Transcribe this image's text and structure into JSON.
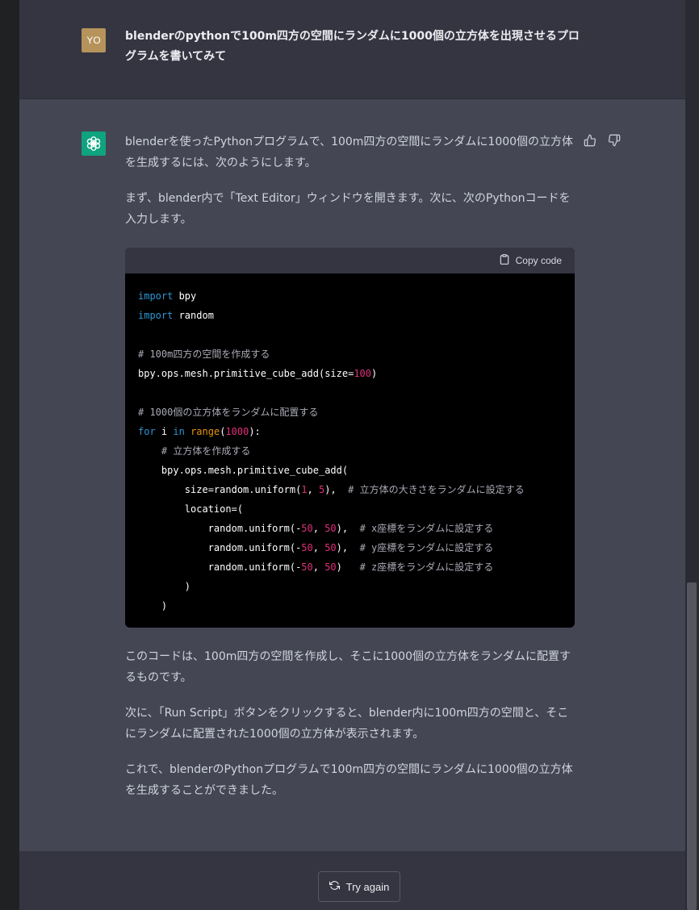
{
  "user_message": {
    "avatar_initials": "YO",
    "text": "blenderのpythonで100m四方の空間にランダムに1000個の立方体を出現させるプログラムを書いてみて"
  },
  "assistant_message": {
    "paragraph_1": "blenderを使ったPythonプログラムで、100m四方の空間にランダムに1000個の立方体を生成するには、次のようにします。",
    "paragraph_2": "まず、blender内で「Text Editor」ウィンドウを開きます。次に、次のPythonコードを入力します。",
    "code_block": {
      "copy_label": "Copy code",
      "lines": [
        {
          "parts": [
            {
              "t": "import",
              "c": "kw"
            },
            {
              "t": " bpy",
              "c": ""
            }
          ]
        },
        {
          "parts": [
            {
              "t": "import",
              "c": "kw"
            },
            {
              "t": " random",
              "c": ""
            }
          ]
        },
        {
          "parts": []
        },
        {
          "parts": [
            {
              "t": "# 100m四方の空間を作成する",
              "c": "cm"
            }
          ]
        },
        {
          "parts": [
            {
              "t": "bpy.ops.mesh.primitive_cube_add(size=",
              "c": ""
            },
            {
              "t": "100",
              "c": "num"
            },
            {
              "t": ")",
              "c": ""
            }
          ]
        },
        {
          "parts": []
        },
        {
          "parts": [
            {
              "t": "# 1000個の立方体をランダムに配置する",
              "c": "cm"
            }
          ]
        },
        {
          "parts": [
            {
              "t": "for",
              "c": "kw"
            },
            {
              "t": " i ",
              "c": ""
            },
            {
              "t": "in",
              "c": "kw"
            },
            {
              "t": " ",
              "c": ""
            },
            {
              "t": "range",
              "c": "fn"
            },
            {
              "t": "(",
              "c": ""
            },
            {
              "t": "1000",
              "c": "num"
            },
            {
              "t": "):",
              "c": ""
            }
          ]
        },
        {
          "parts": [
            {
              "t": "    ",
              "c": ""
            },
            {
              "t": "# 立方体を作成する",
              "c": "cm"
            }
          ]
        },
        {
          "parts": [
            {
              "t": "    bpy.ops.mesh.primitive_cube_add(",
              "c": ""
            }
          ]
        },
        {
          "parts": [
            {
              "t": "        size=random.uniform(",
              "c": ""
            },
            {
              "t": "1",
              "c": "num"
            },
            {
              "t": ", ",
              "c": ""
            },
            {
              "t": "5",
              "c": "num"
            },
            {
              "t": "),  ",
              "c": ""
            },
            {
              "t": "# 立方体の大きさをランダムに設定する",
              "c": "cm"
            }
          ]
        },
        {
          "parts": [
            {
              "t": "        location=(",
              "c": ""
            }
          ]
        },
        {
          "parts": [
            {
              "t": "            random.uniform(-",
              "c": ""
            },
            {
              "t": "50",
              "c": "num"
            },
            {
              "t": ", ",
              "c": ""
            },
            {
              "t": "50",
              "c": "num"
            },
            {
              "t": "),  ",
              "c": ""
            },
            {
              "t": "# x座標をランダムに設定する",
              "c": "cm"
            }
          ]
        },
        {
          "parts": [
            {
              "t": "            random.uniform(-",
              "c": ""
            },
            {
              "t": "50",
              "c": "num"
            },
            {
              "t": ", ",
              "c": ""
            },
            {
              "t": "50",
              "c": "num"
            },
            {
              "t": "),  ",
              "c": ""
            },
            {
              "t": "# y座標をランダムに設定する",
              "c": "cm"
            }
          ]
        },
        {
          "parts": [
            {
              "t": "            random.uniform(-",
              "c": ""
            },
            {
              "t": "50",
              "c": "num"
            },
            {
              "t": ", ",
              "c": ""
            },
            {
              "t": "50",
              "c": "num"
            },
            {
              "t": ")   ",
              "c": ""
            },
            {
              "t": "# z座標をランダムに設定する",
              "c": "cm"
            }
          ]
        },
        {
          "parts": [
            {
              "t": "        )",
              "c": ""
            }
          ]
        },
        {
          "parts": [
            {
              "t": "    )",
              "c": ""
            }
          ]
        }
      ]
    },
    "paragraph_3": "このコードは、100m四方の空間を作成し、そこに1000個の立方体をランダムに配置するものです。",
    "paragraph_4": "次に、「Run Script」ボタンをクリックすると、blender内に100m四方の空間と、そこにランダムに配置された1000個の立方体が表示されます。",
    "paragraph_5": "これで、blenderのPythonプログラムで100m四方の空間にランダムに1000個の立方体を生成することができました。"
  },
  "footer": {
    "try_again_label": "Try again"
  },
  "colors": {
    "user_bg": "#343541",
    "assistant_bg": "#444654",
    "brand_green": "#10a37f",
    "user_avatar": "#b5935a",
    "code_keyword": "#2e95d3",
    "code_function": "#e9950c",
    "code_number": "#df3079"
  }
}
